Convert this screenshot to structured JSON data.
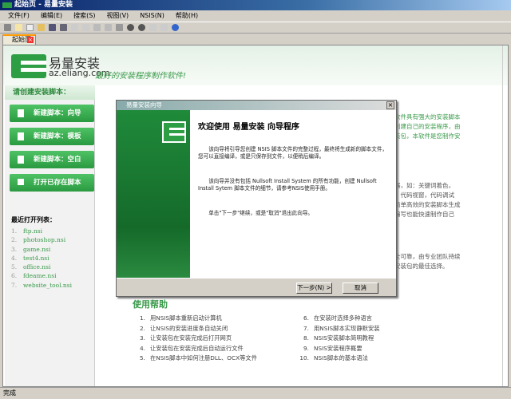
{
  "window": {
    "title": "起始页  - 易量安装"
  },
  "menu": [
    "文件(F)",
    "编辑(E)",
    "搜索(S)",
    "视图(V)",
    "NSIS(N)",
    "帮助(H)"
  ],
  "tab": {
    "label": "起始页"
  },
  "banner": {
    "brand": "易量安装",
    "url": "az.eliang.com",
    "slogan": "最好的安装程序制作软件!"
  },
  "sidebar": {
    "header": "请创建安装脚本：",
    "buttons": [
      "新建脚本：向导",
      "新建脚本：模板",
      "新建脚本：空白",
      "打开已存在脚本"
    ],
    "recent_title": "最近打开列表：",
    "recent": [
      "ftp.nsi",
      "photoshop.nsi",
      "game.nsi",
      "test4.nsi",
      "office.nsi",
      "fdeame.nsi",
      "website_tool.nsi"
    ]
  },
  "background_text": {
    "green": [
      "软件具有强大的安装脚本",
      "创建自己的安装程序，由",
      "装包，本软件是您制作安"
    ],
    "gray1": [
      "器，如：关键词着色，",
      "，代码视窗，代码调试",
      "简单高效的安装脚本生成",
      "编写也能快速制作自己"
    ],
    "gray2": [
      "全可靠，由专业团队持续",
      "安装包的最佳选择。"
    ]
  },
  "help": {
    "title": "使用帮助",
    "items": [
      "用NSIS脚本重新启动计算机",
      "让NSIS的安装进度条自动关闭",
      "让安装包在安装完成后打开网页",
      "让安装包在安装完成后自动运行文件",
      "在NSIS脚本中如何注册DLL、OCX等文件",
      "在安装时选择多种语言",
      "用NSIS脚本实现静默安装",
      "NSIS安装脚本简明教程",
      "NSIS安装程序概要",
      "NSIS脚本的基本语法"
    ]
  },
  "dialog": {
    "title": "易量安装向导",
    "heading": "欢迎使用 易量安装 向导程序",
    "p1": "该向导将引导您创建 NSIS 脚本文件的完整过程，最终将生成新的脚本文件，您可以直接编译，或是只保存到文件，以便稍后编译。",
    "p2": "该向导并没有包括 Nullsoft Install System 的所有功能，创建 Nullsoft Install Sytem 脚本文件的细节，请参考NSIS使用手册。",
    "p3": "单击\"下一步\"继续，或是\"取消\"退出此向导。",
    "next": "下一步(N) >",
    "cancel": "取消",
    "close": "×"
  },
  "status": "完成"
}
